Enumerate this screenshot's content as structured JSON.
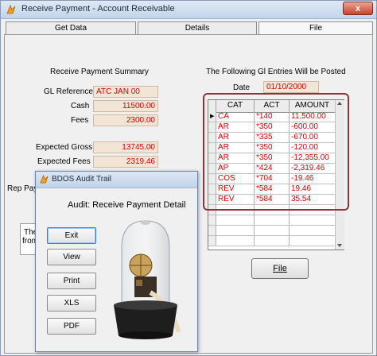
{
  "window": {
    "title": "Receive Payment - Account Receivable",
    "close_glyph": "x"
  },
  "tabs": [
    {
      "label": "Get Data"
    },
    {
      "label": "Details"
    },
    {
      "label": "File"
    }
  ],
  "summary": {
    "heading": "Receive Payment Summary",
    "gl_reference_label": "GL Reference",
    "gl_reference_value": "ATC JAN 00",
    "cash_label": "Cash",
    "cash_value": "11500.00",
    "fees_label": "Fees",
    "fees_value": "2300.00",
    "expected_gross_label": "Expected Gross",
    "expected_gross_value": "13745.00",
    "expected_fees_label": "Expected Fees",
    "expected_fees_value": "2319.46",
    "rep_pay_partial": "Rep Pay",
    "note_partial_1": "The",
    "note_partial_2": "from"
  },
  "gl": {
    "heading": "The Following Gl Entries Will be Posted",
    "date_label": "Date",
    "date_value": "01/10/2000",
    "columns": [
      "CAT",
      "ACT",
      "AMOUNT"
    ],
    "current_row_marker": "▶",
    "rows": [
      {
        "cat": "CA",
        "act": "*140",
        "amount": "11,500.00"
      },
      {
        "cat": "AR",
        "act": "*350",
        "amount": "-600.00"
      },
      {
        "cat": "AR",
        "act": "*335",
        "amount": "-670.00"
      },
      {
        "cat": "AR",
        "act": "*350",
        "amount": "-120.00"
      },
      {
        "cat": "AR",
        "act": "*350",
        "amount": "-12,355.00"
      },
      {
        "cat": "AP",
        "act": "*424",
        "amount": "-2,319.46"
      },
      {
        "cat": "COS",
        "act": "*704",
        "amount": "-19.46"
      },
      {
        "cat": "REV",
        "act": "*584",
        "amount": "19.46"
      },
      {
        "cat": "REV",
        "act": "*584",
        "amount": "35.54"
      }
    ],
    "file_button": "File"
  },
  "audit_dialog": {
    "title": "BDOS Audit Trail",
    "subtitle": "Audit: Receive Payment Detail",
    "buttons": [
      "Exit",
      "View",
      "Print",
      "XLS",
      "PDF"
    ]
  },
  "colors": {
    "value_text": "#e00000",
    "field_bg": "#f3e5d6",
    "highlight_border": "#8b3538"
  }
}
